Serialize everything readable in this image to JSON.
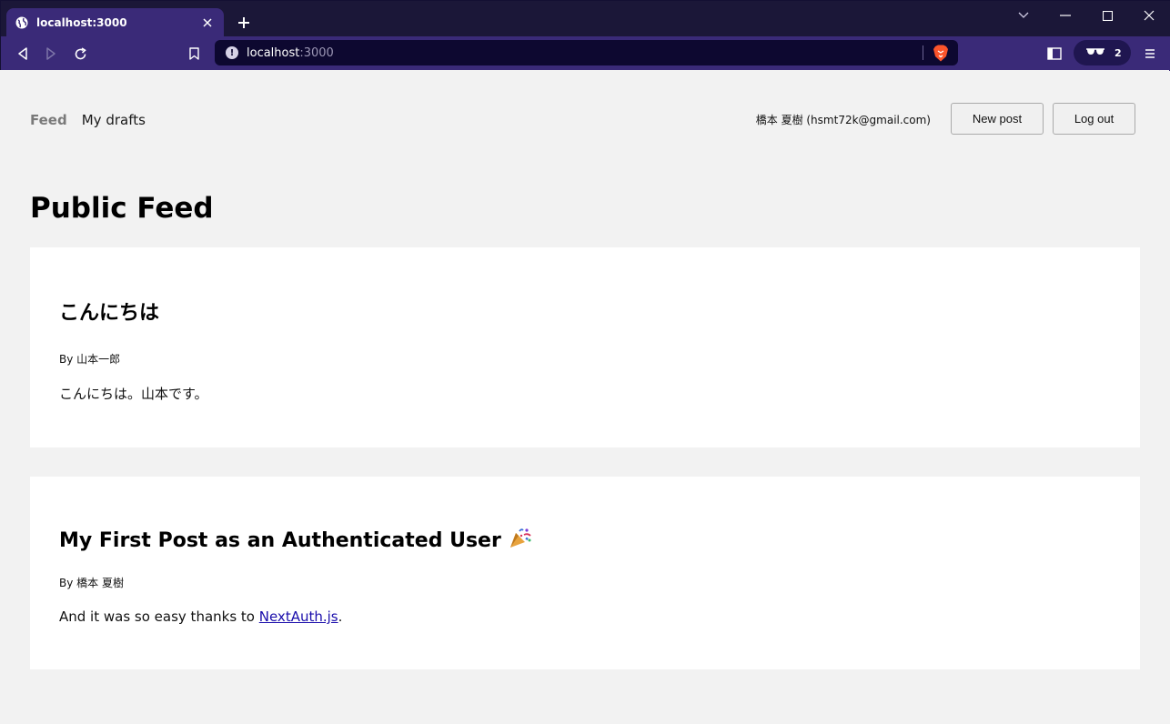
{
  "browser": {
    "tab_title": "localhost:3000",
    "url_host": "localhost",
    "url_port": ":3000",
    "shields_count": "2",
    "icons": {
      "tab_favicon": "globe-icon",
      "tab_close": "close-icon",
      "new_tab": "plus-icon",
      "back": "back-icon",
      "forward": "forward-icon",
      "reload": "reload-icon",
      "bookmark": "bookmark-icon",
      "site_info": "info-icon",
      "brave_shields": "brave-lion-icon",
      "sidebar": "sidebar-icon",
      "private": "sunglasses-icon",
      "menu": "hamburger-menu-icon"
    },
    "accent_color": "#3a2a78"
  },
  "nav": {
    "feed_label": "Feed",
    "drafts_label": "My drafts",
    "user_info": "橋本 夏樹 (hsmt72k@gmail.com)",
    "new_post_label": "New post",
    "logout_label": "Log out"
  },
  "main": {
    "title": "Public Feed",
    "posts": [
      {
        "title": "こんにちは",
        "author": "By 山本一郎",
        "body": "こんにちは。山本です。"
      },
      {
        "title": "My First Post as an Authenticated User",
        "title_icon": "party-popper-icon",
        "author": "By 橋本 夏樹",
        "body_prefix": "And it was so easy thanks to ",
        "body_link": "NextAuth.js",
        "body_suffix": "."
      }
    ]
  }
}
